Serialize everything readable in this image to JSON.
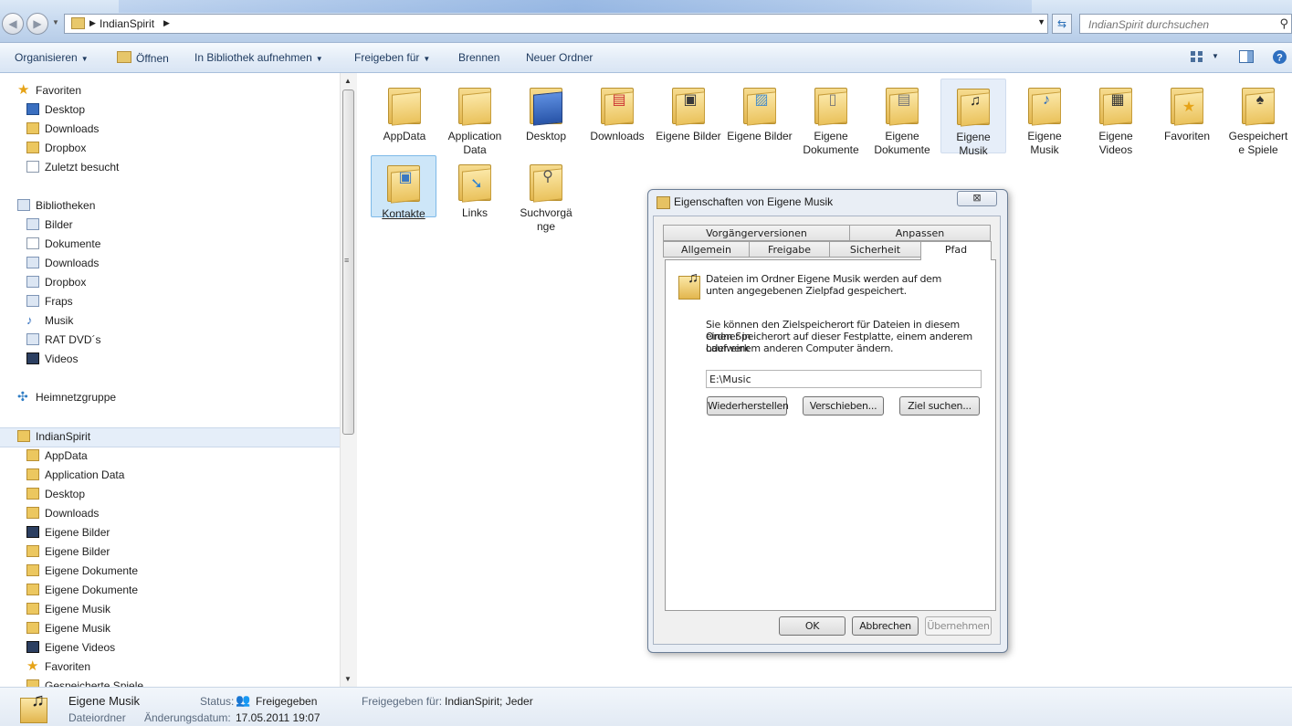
{
  "address": {
    "crumb": "IndianSpirit",
    "search_placeholder": "IndianSpirit durchsuchen"
  },
  "toolbar": {
    "organize": "Organisieren",
    "open": "Öffnen",
    "include_library": "In Bibliothek aufnehmen",
    "share_with": "Freigeben für",
    "burn": "Brennen",
    "new_folder": "Neuer Ordner"
  },
  "nav": {
    "favorites": {
      "label": "Favoriten",
      "items": [
        "Desktop",
        "Downloads",
        "Dropbox",
        "Zuletzt besucht"
      ]
    },
    "libraries": {
      "label": "Bibliotheken",
      "items": [
        "Bilder",
        "Dokumente",
        "Downloads",
        "Dropbox",
        "Fraps",
        "Musik",
        "RAT DVD´s",
        "Videos"
      ]
    },
    "homegroup": "Heimnetzgruppe",
    "user": {
      "label": "IndianSpirit",
      "items": [
        "AppData",
        "Application Data",
        "Desktop",
        "Downloads",
        "Eigene Bilder",
        "Eigene Bilder",
        "Eigene Dokumente",
        "Eigene Dokumente",
        "Eigene Musik",
        "Eigene Musik",
        "Eigene Videos",
        "Favoriten",
        "Gespeicherte Spiele"
      ]
    }
  },
  "files": [
    {
      "name": "AppData",
      "icon": "folder-icon"
    },
    {
      "name": "Application Data",
      "icon": "folder-shortcut-icon"
    },
    {
      "name": "Desktop",
      "icon": "desktop-folder-icon"
    },
    {
      "name": "Downloads",
      "icon": "downloads-folder-icon"
    },
    {
      "name": "Eigene Bilder",
      "icon": "pictures-folder-icon"
    },
    {
      "name": "Eigene Bilder",
      "icon": "pictures-folder-icon"
    },
    {
      "name": "Eigene Dokumente",
      "icon": "documents-folder-icon"
    },
    {
      "name": "Eigene Dokumente",
      "icon": "documents-folder-icon"
    },
    {
      "name": "Eigene Musik",
      "icon": "music-folder-icon"
    },
    {
      "name": "Eigene Musik",
      "icon": "music-folder-icon"
    },
    {
      "name": "Eigene Videos",
      "icon": "videos-folder-icon"
    },
    {
      "name": "Favoriten",
      "icon": "favorites-folder-icon"
    },
    {
      "name": "Gespeichert e Spiele",
      "icon": "games-folder-icon"
    },
    {
      "name": "Kontakte",
      "icon": "contacts-folder-icon"
    },
    {
      "name": "Links",
      "icon": "links-folder-icon"
    },
    {
      "name": "Suchvorgä nge",
      "icon": "searches-folder-icon"
    }
  ],
  "dialog": {
    "title": "Eigenschaften von Eigene Musik",
    "close": "⊠",
    "tabs_back": [
      "Vorgängerversionen",
      "Anpassen"
    ],
    "tabs_front": [
      "Allgemein",
      "Freigabe",
      "Sicherheit",
      "Pfad"
    ],
    "text1_line1": "Dateien im Ordner Eigene Musik werden auf dem",
    "text1_line2": "unten angegebenen Zielpfad gespeichert.",
    "text2_line1": "Sie können den Zielspeicherort für Dateien in diesem Ordner in",
    "text2_line2": "einen Speicherort auf dieser Festplatte, einem anderem Laufwerk",
    "text2_line3": "oder einem anderen Computer ändern.",
    "path_value": "E:\\Music",
    "btn_restore": "Wiederherstellen",
    "btn_move": "Verschieben...",
    "btn_find": "Ziel suchen...",
    "btn_ok": "OK",
    "btn_cancel": "Abbrechen",
    "btn_apply": "Übernehmen"
  },
  "status": {
    "name": "Eigene Musik",
    "type": "Dateiordner",
    "status_label": "Status:",
    "status_value": "Freigegeben",
    "shared_label": "Freigegeben für:",
    "shared_value": "IndianSpirit; Jeder",
    "modified_label": "Änderungsdatum:",
    "modified_value": "17.05.2011 19:07"
  },
  "colors": {
    "accent": "#2a6fb7",
    "selection": "#cde6f8"
  }
}
